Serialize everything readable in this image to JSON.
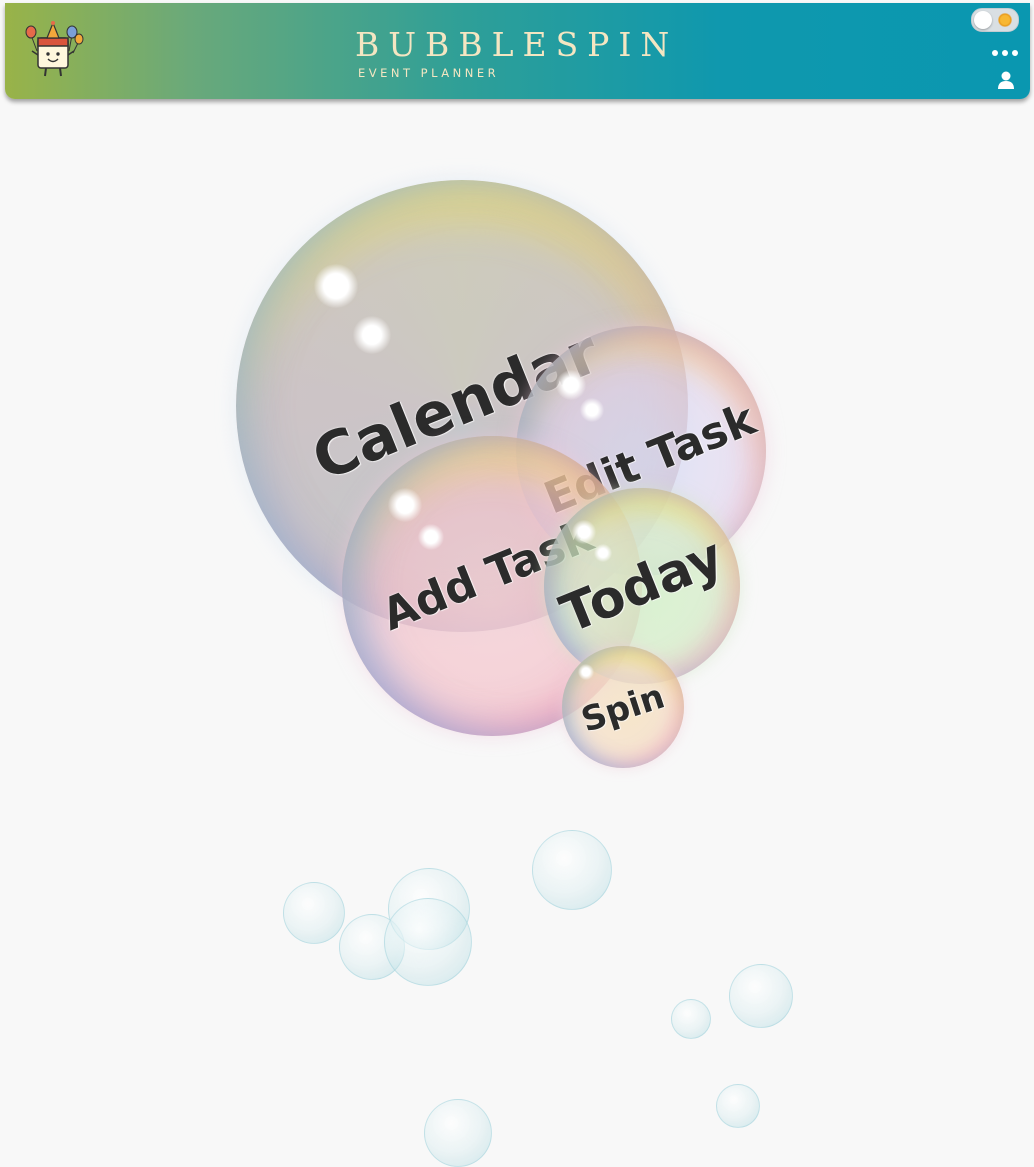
{
  "header": {
    "brand_title": "BUBBLESPIN",
    "brand_subtitle": "EVENT PLANNER",
    "mascot_icon": "party-calendar-mascot-icon",
    "theme_toggle_icon": "sun-icon",
    "more_icon": "more-dots-icon",
    "user_icon": "user-icon"
  },
  "bubbles": [
    {
      "label": "Calendar"
    },
    {
      "label": "Edit Task"
    },
    {
      "label": "Add Task"
    },
    {
      "label": "Today"
    },
    {
      "label": "Spin"
    }
  ],
  "colors": {
    "header_start": "#99b348",
    "header_end": "#0a97b0",
    "brand_text": "#f4e6c2",
    "background": "#f8f8f8"
  }
}
